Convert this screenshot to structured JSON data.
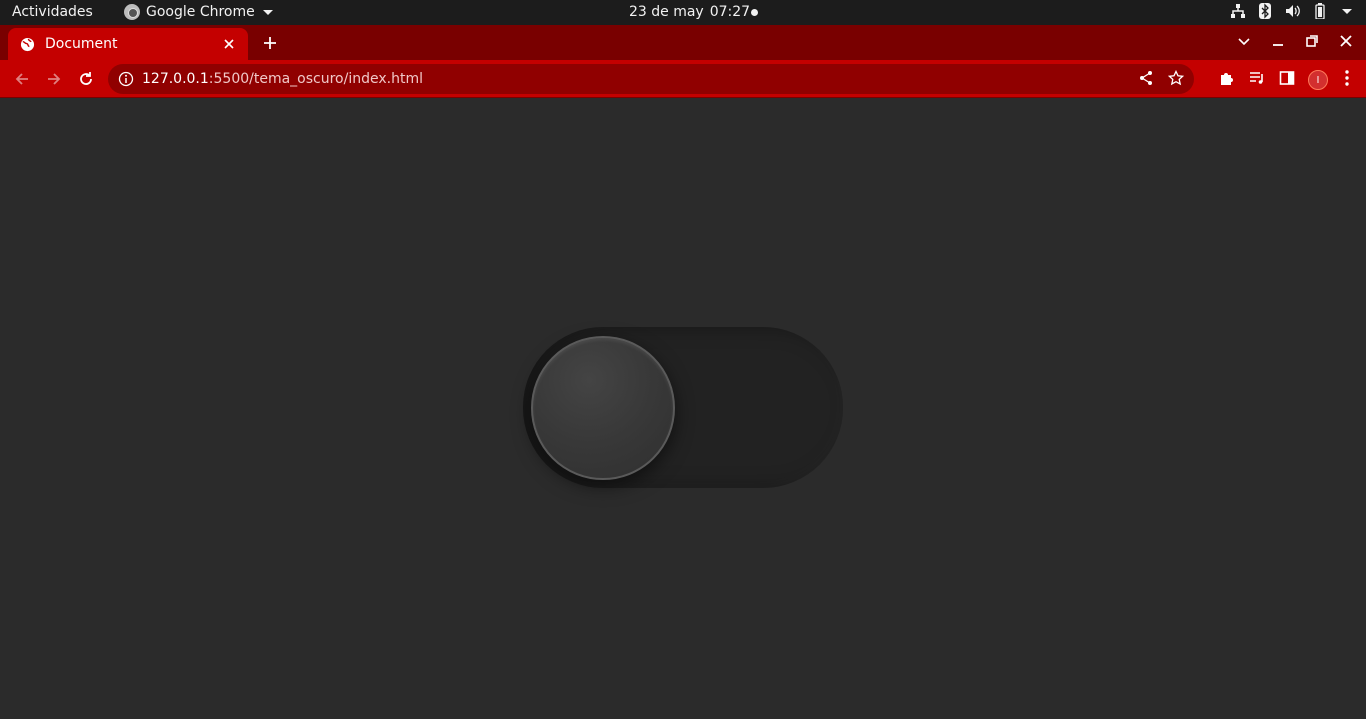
{
  "topbar": {
    "activities_label": "Actividades",
    "app_name": "Google Chrome",
    "date": "23 de may",
    "time": "07:27"
  },
  "tabs": [
    {
      "title": "Document"
    }
  ],
  "toolbar": {
    "url_host": "127.0.0.1",
    "url_path": ":5500/tema_oscuro/index.html",
    "profile_initial": "I"
  },
  "page": {
    "toggle_state": "off"
  },
  "colors": {
    "accent": "#c40000",
    "tabstrip": "#790000",
    "omnibox": "#900000",
    "page_background": "#2b2b2b",
    "switch_track": "#222222"
  }
}
